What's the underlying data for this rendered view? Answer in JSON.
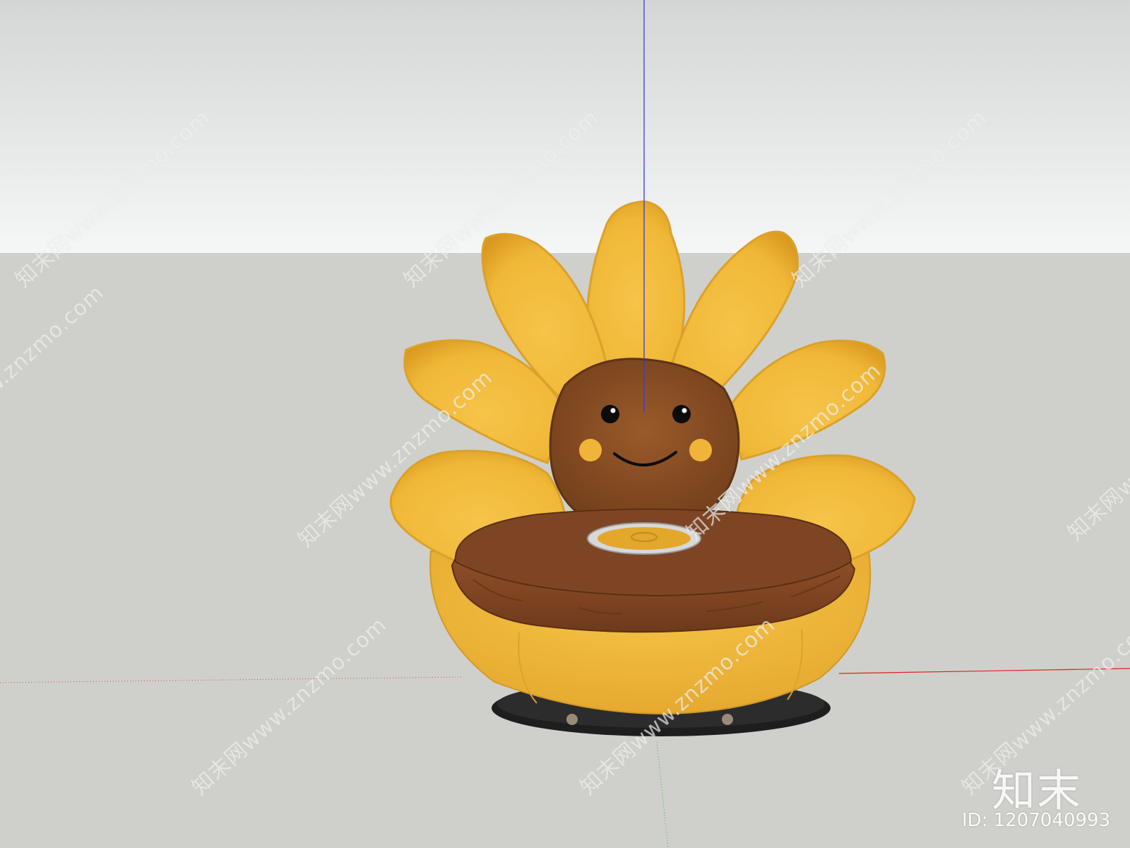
{
  "scene": {
    "colors": {
      "sky_top": "#d6d8d8",
      "sky_bottom": "#f4f5f5",
      "ground": "#cfd0cb",
      "petal": "#f2bf3f",
      "petal_dark": "#d89a22",
      "face": "#8e4f23",
      "cushion": "#7a4424",
      "cushion_side": "#8c4b26",
      "base": "#efbb3c",
      "blue_axis": "#3333cc",
      "red_axis": "#cc2222",
      "green_axis": "#33aa33"
    },
    "object": "sunflower-chair"
  },
  "watermark": {
    "text": "知末网www.znzmo.com"
  },
  "brand": {
    "logo": "知末",
    "id_label": "ID: 1207040993"
  }
}
